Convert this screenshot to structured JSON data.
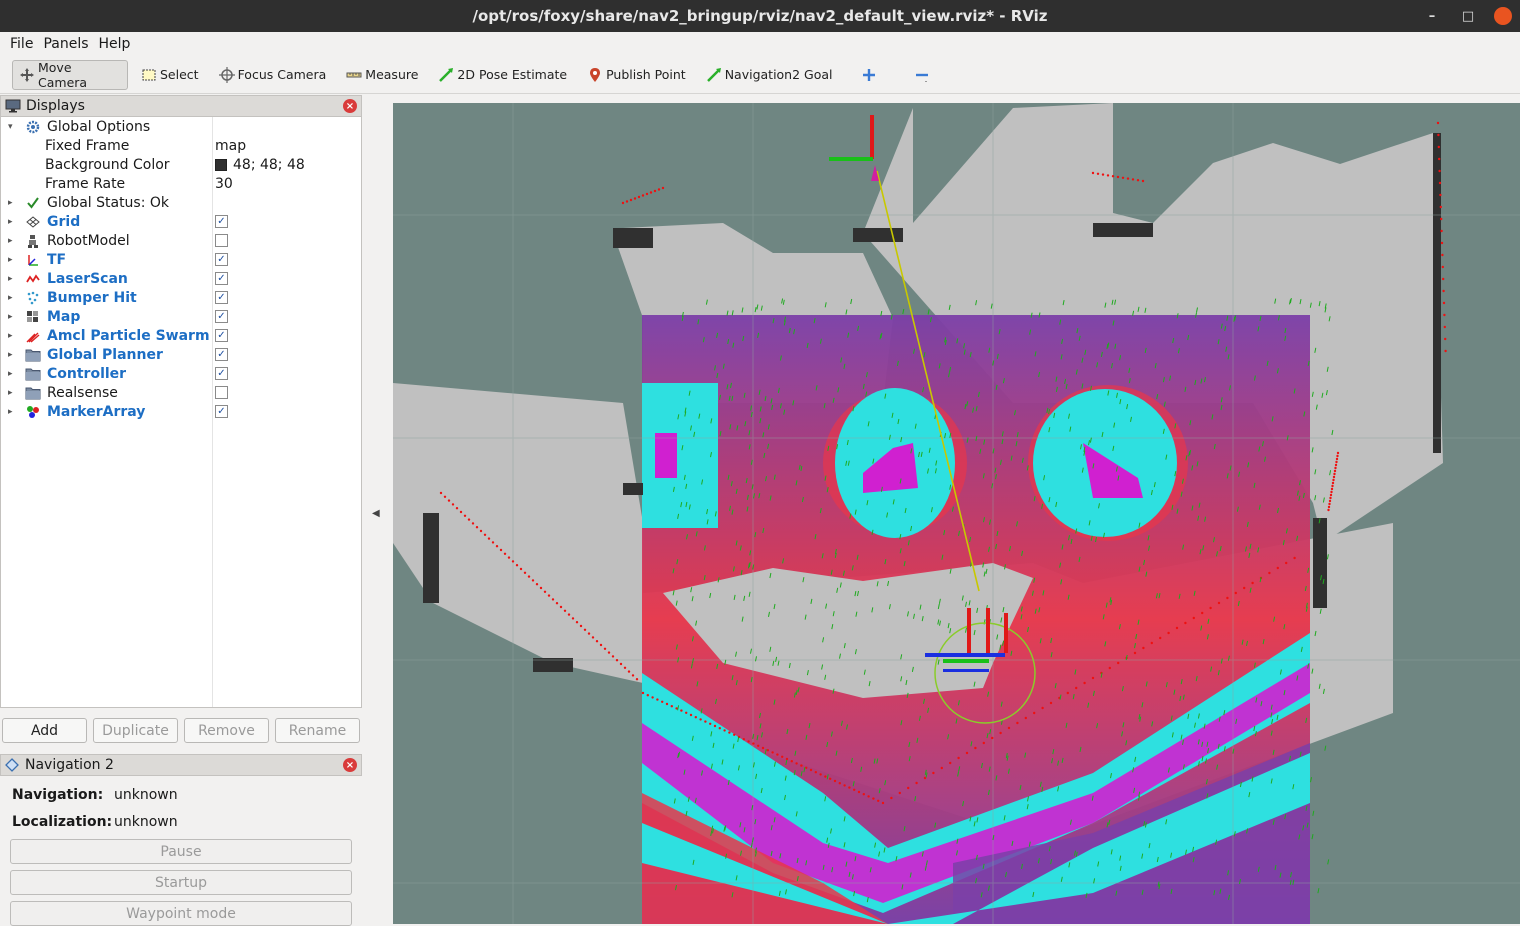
{
  "window": {
    "title": "/opt/ros/foxy/share/nav2_bringup/rviz/nav2_default_view.rviz* - RViz"
  },
  "menu": [
    "File",
    "Panels",
    "Help"
  ],
  "toolbar": {
    "tools": [
      {
        "label": "Move Camera",
        "icon": "move-camera-icon",
        "active": true
      },
      {
        "label": "Select",
        "icon": "select-icon"
      },
      {
        "label": "Focus Camera",
        "icon": "focus-camera-icon"
      },
      {
        "label": "Measure",
        "icon": "measure-icon"
      },
      {
        "label": "2D Pose Estimate",
        "icon": "pose-estimate-icon"
      },
      {
        "label": "Publish Point",
        "icon": "publish-point-icon"
      },
      {
        "label": "Navigation2 Goal",
        "icon": "nav-goal-icon"
      }
    ]
  },
  "displays": {
    "title": "Displays",
    "global_options": "Global Options",
    "fixed_frame_label": "Fixed Frame",
    "fixed_frame": "map",
    "background_color_label": "Background Color",
    "background_color": "48; 48; 48",
    "frame_rate_label": "Frame Rate",
    "frame_rate": "30",
    "global_status": "Global Status: Ok",
    "items": [
      {
        "label": "Grid",
        "checked": true,
        "blue": true
      },
      {
        "label": "RobotModel",
        "checked": false,
        "blue": false
      },
      {
        "label": "TF",
        "checked": true,
        "blue": true
      },
      {
        "label": "LaserScan",
        "checked": true,
        "blue": true
      },
      {
        "label": "Bumper Hit",
        "checked": true,
        "blue": true
      },
      {
        "label": "Map",
        "checked": true,
        "blue": true
      },
      {
        "label": "Amcl Particle Swarm",
        "checked": true,
        "blue": true
      },
      {
        "label": "Global Planner",
        "checked": true,
        "blue": true
      },
      {
        "label": "Controller",
        "checked": true,
        "blue": true
      },
      {
        "label": "Realsense",
        "checked": false,
        "blue": false
      },
      {
        "label": "MarkerArray",
        "checked": true,
        "blue": true
      }
    ],
    "buttons": {
      "add": "Add",
      "duplicate": "Duplicate",
      "remove": "Remove",
      "rename": "Rename"
    }
  },
  "nav2": {
    "title": "Navigation 2",
    "navigation_label": "Navigation:",
    "navigation_value": "unknown",
    "localization_label": "Localization:",
    "localization_value": "unknown",
    "pause": "Pause",
    "startup": "Startup",
    "waypoint": "Waypoint mode"
  },
  "colors": {
    "viewport_bg": "#6f8682",
    "map_free": "#c0c0c0",
    "costmap_cyan": "#2ee0e0",
    "costmap_magenta": "#d020d0",
    "costmap_red": "#e8364a",
    "costmap_purple": "#7b3fa8"
  }
}
